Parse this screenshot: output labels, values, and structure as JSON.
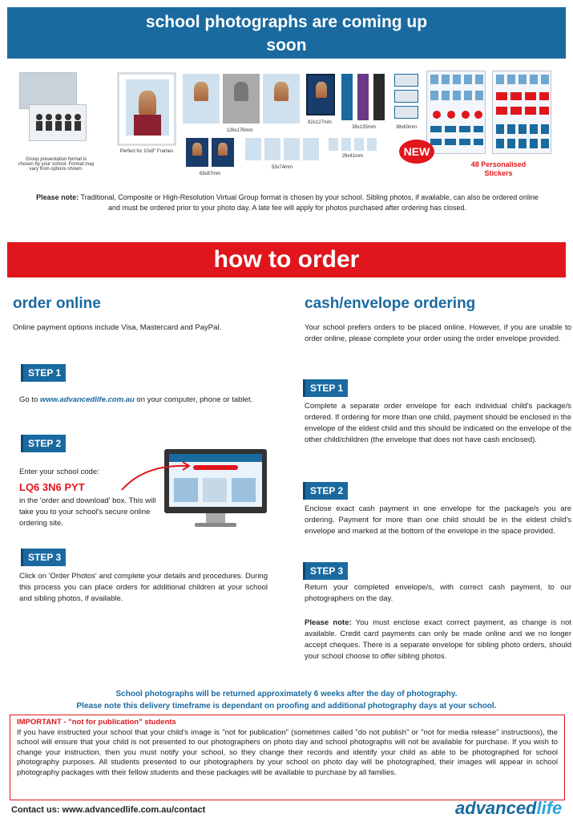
{
  "header": {
    "title_line1": "school photographs are coming up",
    "title_line2": "soon"
  },
  "products": {
    "group_caption": "Group presentation format is chosen by your school. Format may vary from options shown.",
    "frame_caption": "Perfect for 10x8\" Frames",
    "size_126x176": "126x176mm",
    "size_82x127": "82x127mm",
    "size_38x135": "38x135mm",
    "size_38x63": "38x63mm",
    "size_63x87": "63x87mm",
    "size_53x74": "53x74mm",
    "size_29x41": "29x41mm",
    "new_badge": "NEW",
    "stickers_line1": "48 Personalised",
    "stickers_line2": "Stickers"
  },
  "top_note": {
    "lead": "Please note:",
    "text": " Traditional, Composite or High-Resolution Virtual Group format is chosen by your school. Sibling photos, if available, can also be ordered online and must be ordered prior to your photo day. A late fee will apply for photos purchased after ordering has closed."
  },
  "how_to_order": "how to order",
  "online": {
    "heading": "order online",
    "intro": "Online payment options include Visa, Mastercard and PayPal.",
    "step1_label": "STEP 1",
    "step1_pre": "Go to ",
    "step1_url": "www.advancedlife.com.au",
    "step1_post": " on your computer, phone or tablet.",
    "step2_label": "STEP 2",
    "step2_prompt": "Enter your school code:",
    "school_code": "LQ6 3N6 PYT",
    "step2_text": "in the 'order and download' box. This will take you to your school's secure online ordering site.",
    "step3_label": "STEP 3",
    "step3_text": "Click on 'Order Photos' and complete your details and procedures. During this process you can place orders for additional children at your school and sibling photos, if available."
  },
  "cash": {
    "heading": "cash/envelope ordering",
    "intro": "Your school prefers orders to be placed online. However, if you are unable to order online, please complete your order using the order envelope provided.",
    "step1_label": "STEP 1",
    "step1_text": "Complete a separate order envelope for each individual child's package/s ordered. If ordering for more than one child, payment should be enclosed in the envelope of the eldest child and this should be indicated on the envelope of the other child/children (the envelope that does not have cash enclosed).",
    "step2_label": "STEP 2",
    "step2_text": "Enclose exact cash payment in one envelope for the package/s you are ordering. Payment for more than one child should be in the eldest child's envelope and marked at the bottom of the envelope in the space provided.",
    "step3_label": "STEP 3",
    "step3_text": "Return your completed envelope/s, with correct cash payment, to our photographers on the day.",
    "note_lead": "Please note:",
    "note_text": " You must enclose exact correct payment, as change is not available. Credit card payments can only be made online and we no longer accept cheques. There is a separate envelope for sibling photo orders, should your school choose to offer sibling photos."
  },
  "return_note": {
    "line1": "School photographs will be returned approximately 6 weeks after the day of photography.",
    "line2": "Please note this delivery timeframe is dependant on proofing and additional photography days at your school."
  },
  "important": {
    "heading": "IMPORTANT - \"not for publication\" students",
    "text": "If you have instructed your school that your child's image is \"not for publication\" (sometimes called \"do not publish\" or \"not for media release\" instructions), the school will ensure that your child is not presented to our photographers on photo day and school photographs will not be available for purchase. If you wish to change your instruction, then you must notify your school, so they change their records and identify your child as able to be photographed for school photography purposes. All students presented to our photographers by your school on photo day will be photographed, their images will appear in school photography packages with their fellow students and these packages will be available to purchase by all families."
  },
  "footer": {
    "contact": "Contact us: www.advancedlife.com.au/contact",
    "logo_part1": "advanced",
    "logo_part2": "life"
  },
  "colors": {
    "blue": "#1a6aa0",
    "red": "#e0161c"
  }
}
